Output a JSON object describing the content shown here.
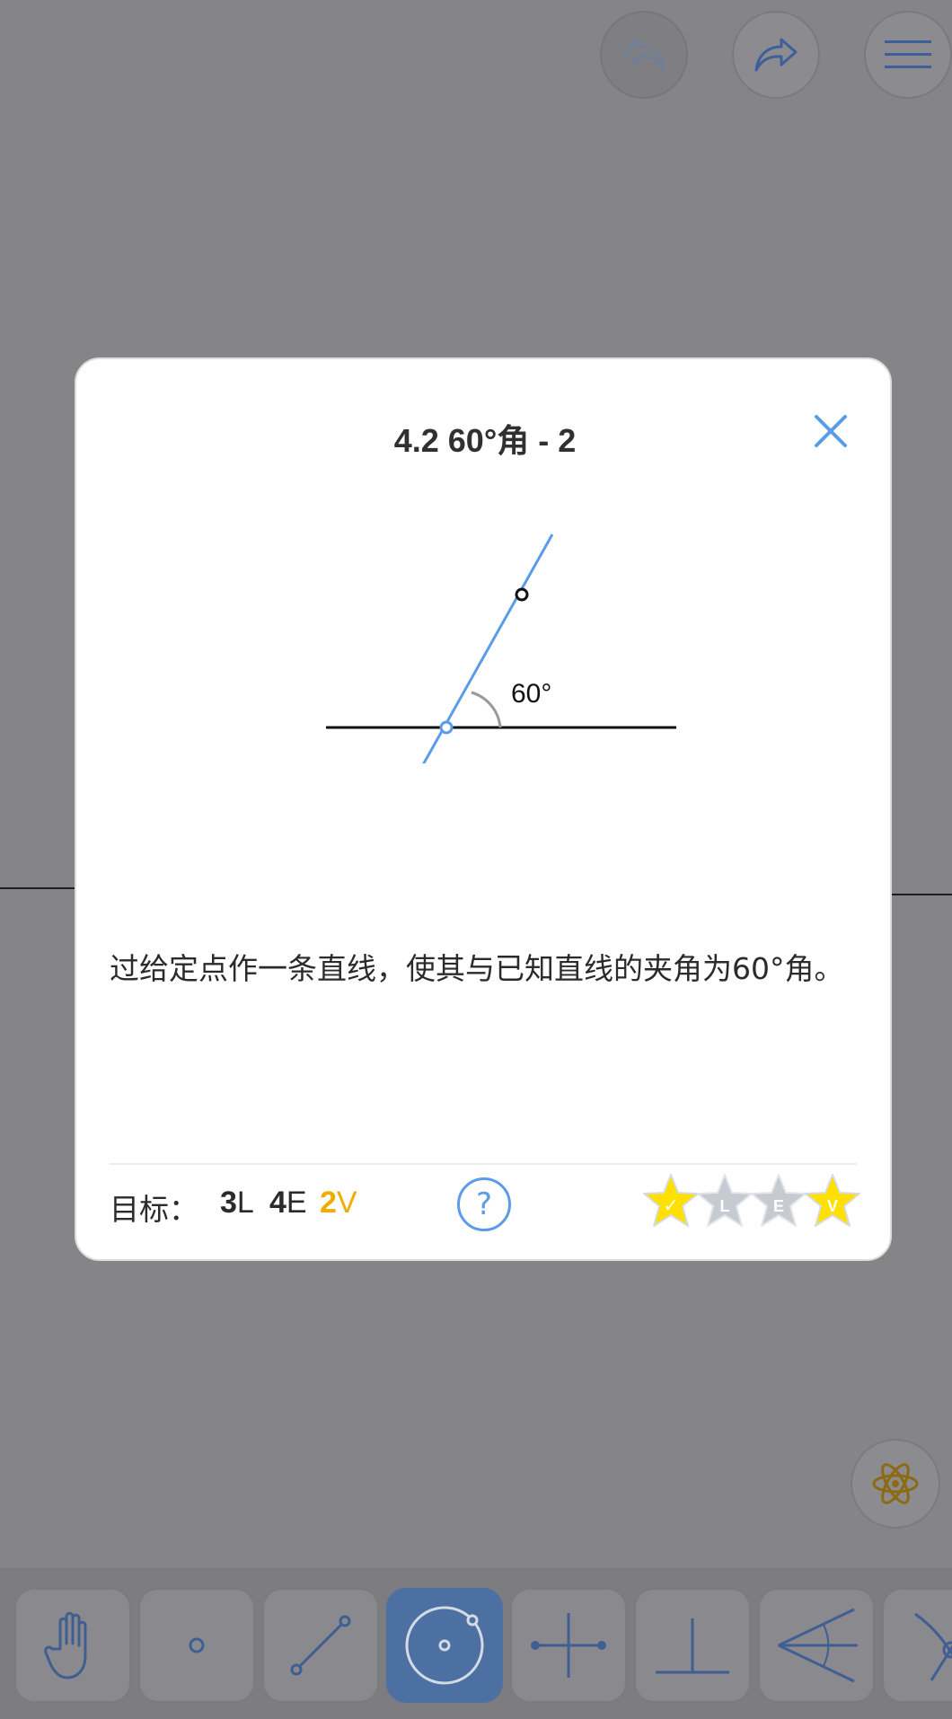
{
  "app": {
    "header": {
      "undo_icon": "undo-icon",
      "redo_icon": "redo-icon",
      "menu_icon": "hamburger-menu-icon"
    },
    "toolbar": {
      "tools": [
        {
          "name": "move",
          "icon": "hand-icon"
        },
        {
          "name": "point",
          "icon": "point-icon"
        },
        {
          "name": "line",
          "icon": "line-icon"
        },
        {
          "name": "circle",
          "icon": "circle-icon",
          "active": true
        },
        {
          "name": "perpendicular-bisector",
          "icon": "perpendicular-bisector-icon"
        },
        {
          "name": "perpendicular",
          "icon": "perpendicular-icon"
        },
        {
          "name": "angle-bisector",
          "icon": "angle-bisector-icon"
        },
        {
          "name": "intersect",
          "icon": "intersect-icon"
        }
      ]
    },
    "fab_icon": "atom-icon"
  },
  "modal": {
    "title": "4.2 60°角 - 2",
    "diagram": {
      "angle_label": "60°"
    },
    "description": "过给定点作一条直线，使其与已知直线的夹角为60°角。",
    "goal_label": "目标：",
    "goals": [
      {
        "num": "3",
        "unit": "L"
      },
      {
        "num": "4",
        "unit": "E"
      },
      {
        "num": "2",
        "unit": "V"
      }
    ],
    "help_label": "?",
    "stars": [
      {
        "label": "✓",
        "achieved": true
      },
      {
        "label": "L",
        "achieved": false
      },
      {
        "label": "E",
        "achieved": false
      },
      {
        "label": "V",
        "achieved": true
      }
    ]
  },
  "colors": {
    "accent_blue": "#5b9be8",
    "gold": "#f0ad00",
    "star_gold": "#ffe000",
    "star_gray": "#c6cad1"
  }
}
